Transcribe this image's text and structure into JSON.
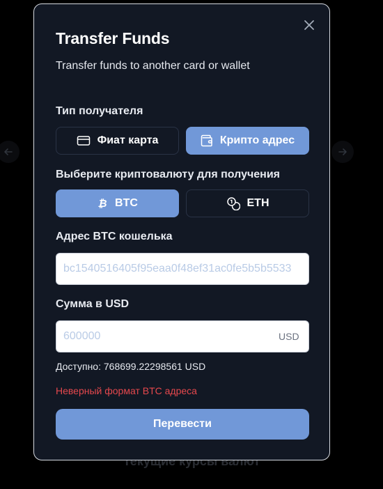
{
  "background": {
    "heading": "Текущие курсы валют",
    "nav_prev_icon": "arrow-left-icon",
    "nav_next_icon": "arrow-right-icon"
  },
  "modal": {
    "title": "Transfer Funds",
    "subtitle": "Transfer funds to another card or wallet",
    "close_icon": "close-icon",
    "recipient_type": {
      "label": "Тип получателя",
      "options": [
        {
          "label": "Фиат карта",
          "icon": "credit-card-icon",
          "selected": false
        },
        {
          "label": "Крипто адрес",
          "icon": "wallet-icon",
          "selected": true
        }
      ]
    },
    "crypto": {
      "label": "Выберите криптовалюту для получения",
      "options": [
        {
          "label": "BTC",
          "icon": "bitcoin-icon",
          "selected": true
        },
        {
          "label": "ETH",
          "icon": "coins-icon",
          "selected": false
        }
      ]
    },
    "address": {
      "label": "Адрес BTC кошелька",
      "value": "bc1540516405f95eaa0f48ef31ac0fe5b5b5533"
    },
    "amount": {
      "label": "Сумма в USD",
      "placeholder": "600000",
      "currency": "USD"
    },
    "available": "Доступно: 768699.22298561 USD",
    "error": "Неверный формат BTC адреса",
    "submit_label": "Перевести"
  },
  "colors": {
    "accent": "#7198d8",
    "modal_bg": "#121824",
    "error": "#e5484d"
  }
}
